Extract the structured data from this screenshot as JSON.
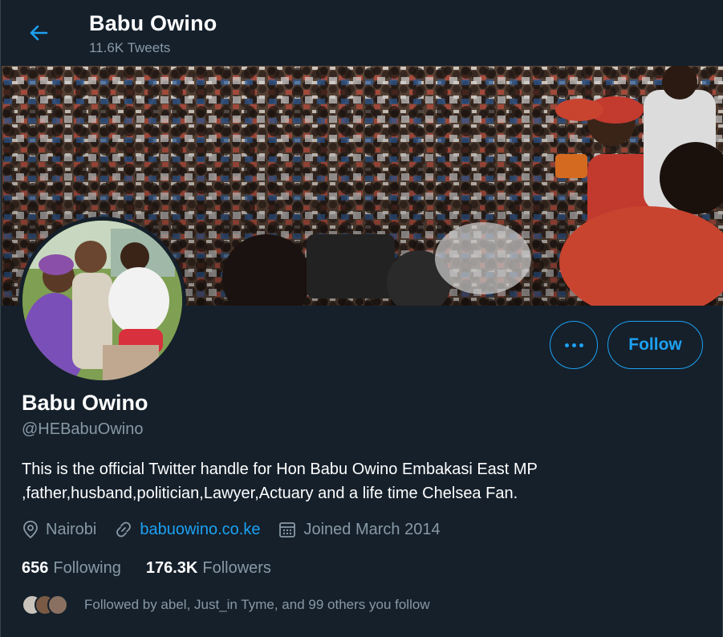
{
  "header": {
    "title": "Babu Owino",
    "tweet_count": "11.6K Tweets",
    "back_icon": "arrow-left-icon"
  },
  "colors": {
    "background": "#15202b",
    "accent": "#1da1f2",
    "secondary_text": "#8899a6",
    "border": "#38444d"
  },
  "actions": {
    "more_icon": "ellipsis-icon",
    "follow_label": "Follow"
  },
  "profile": {
    "name": "Babu Owino",
    "handle": "@HEBabuOwino",
    "bio_line1": "This is the official Twitter handle for Hon Babu Owino Embakasi East MP",
    "bio_line2": ",father,husband,politician,Lawyer,Actuary and a life time Chelsea Fan.",
    "location": "Nairobi",
    "website": "babuowino.co.ke",
    "joined": "Joined March 2014"
  },
  "stats": {
    "following_count": "656",
    "following_label": "Following",
    "followers_count": "176.3K",
    "followers_label": "Followers"
  },
  "followed_by": {
    "text": "Followed by abel, Just_in Tyme, and 99 others you follow"
  }
}
